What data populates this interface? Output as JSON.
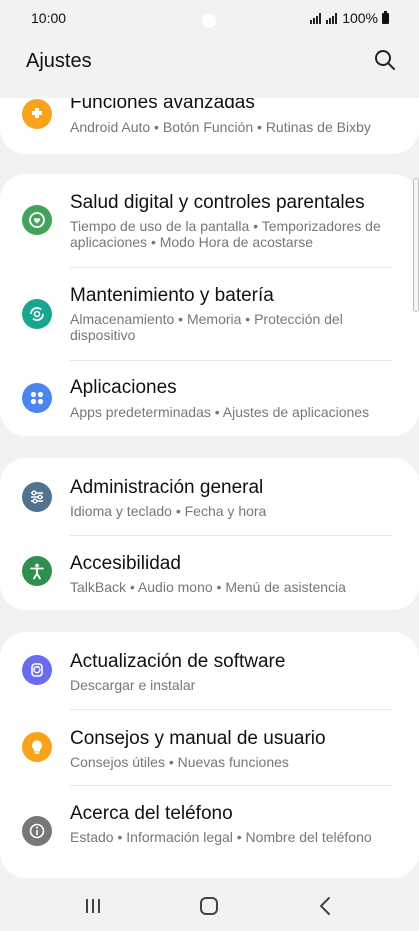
{
  "status_bar": {
    "time": "10:00",
    "battery": "100%"
  },
  "header": {
    "title": "Ajustes",
    "search_icon": "search-icon"
  },
  "cards": [
    {
      "items": [
        {
          "title": "Funciones avanzadas",
          "subtitle": "Android Auto  •  Botón Función  •  Rutinas de Bixby",
          "icon": "puzzle-icon",
          "color": "#f7a31b"
        }
      ]
    },
    {
      "items": [
        {
          "title": "Salud digital y controles parentales",
          "subtitle": "Tiempo de uso de la pantalla  •  Temporizadores de aplicaciones  •  Modo Hora de acostarse",
          "icon": "digital-wellbeing-icon",
          "color": "#43a35a"
        },
        {
          "title": "Mantenimiento y batería",
          "subtitle": "Almacenamiento  •  Memoria  •  Protección del dispositivo",
          "icon": "device-care-icon",
          "color": "#18a693"
        },
        {
          "title": "Aplicaciones",
          "subtitle": "Apps predeterminadas  •  Ajustes de aplicaciones",
          "icon": "apps-icon",
          "color": "#4b86f0"
        }
      ]
    },
    {
      "items": [
        {
          "title": "Administración general",
          "subtitle": "Idioma y teclado  •  Fecha y hora",
          "icon": "sliders-icon",
          "color": "#52738e"
        },
        {
          "title": "Accesibilidad",
          "subtitle": "TalkBack  •  Audio mono  •  Menú de asistencia",
          "icon": "accessibility-icon",
          "color": "#2f8f4e"
        }
      ]
    },
    {
      "items": [
        {
          "title": "Actualización de software",
          "subtitle": "Descargar e instalar",
          "icon": "software-update-icon",
          "color": "#6b6bf0"
        },
        {
          "title": "Consejos y manual de usuario",
          "subtitle": "Consejos útiles  •  Nuevas funciones",
          "icon": "lightbulb-icon",
          "color": "#f7a31b"
        },
        {
          "title": "Acerca del teléfono",
          "subtitle": "Estado  •  Información legal  •  Nombre del teléfono",
          "icon": "info-icon",
          "color": "#777777"
        }
      ]
    }
  ],
  "nav_bar": {
    "recents": "recents-icon",
    "home": "home-icon",
    "back": "back-icon"
  }
}
